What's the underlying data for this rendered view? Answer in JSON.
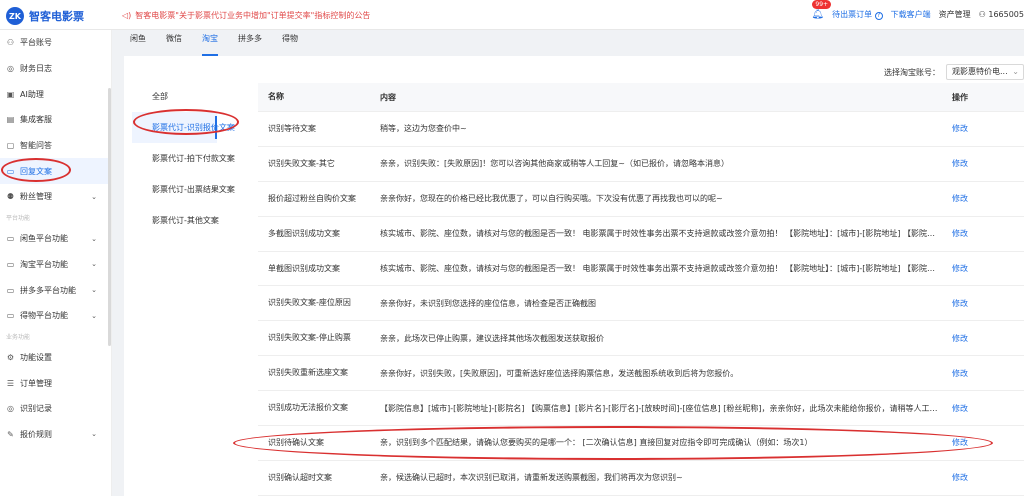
{
  "app": {
    "logo_mark": "ZK",
    "name": "智客电影票"
  },
  "notice": {
    "icon": "speaker-icon",
    "text": "智客电影票\"关于影票代订业务中增加\"订单提交率\"指标控制的公告"
  },
  "header": {
    "badge": "99+",
    "pending_orders": "待出票订单",
    "download": "下载客户端",
    "asset_mgmt": "资产管理",
    "user_id": "1665005"
  },
  "sidebar": {
    "items": [
      {
        "icon": "user-icon",
        "glyph": "⚇",
        "label": "平台账号",
        "chev": false
      },
      {
        "icon": "finance-icon",
        "glyph": "◎",
        "label": "财务日志",
        "chev": false
      },
      {
        "icon": "ai-icon",
        "glyph": "▣",
        "label": "AI助理",
        "chev": false
      },
      {
        "icon": "service-icon",
        "glyph": "▤",
        "label": "集成客服",
        "chev": false
      },
      {
        "icon": "qa-icon",
        "glyph": "▢",
        "label": "智能问答",
        "chev": false
      },
      {
        "icon": "reply-icon",
        "glyph": "▭",
        "label": "回复文案",
        "chev": false,
        "active": true
      },
      {
        "icon": "fans-icon",
        "glyph": "⚉",
        "label": "粉丝管理",
        "chev": true
      }
    ],
    "section1": "平台功能",
    "platform_items": [
      {
        "icon": "xianyu-icon",
        "glyph": "▭",
        "label": "闲鱼平台功能"
      },
      {
        "icon": "taobao-icon",
        "glyph": "▭",
        "label": "淘宝平台功能"
      },
      {
        "icon": "pdd-icon",
        "glyph": "▭",
        "label": "拼多多平台功能"
      },
      {
        "icon": "dewu-icon",
        "glyph": "▭",
        "label": "得物平台功能"
      }
    ],
    "section2": "业务功能",
    "biz_items": [
      {
        "icon": "settings-icon",
        "glyph": "⚙",
        "label": "功能设置",
        "chev": false
      },
      {
        "icon": "order-icon",
        "glyph": "☰",
        "label": "订单管理",
        "chev": false
      },
      {
        "icon": "record-icon",
        "glyph": "◎",
        "label": "识别记录",
        "chev": false
      },
      {
        "icon": "price-icon",
        "glyph": "✎",
        "label": "报价规则",
        "chev": true
      }
    ]
  },
  "platform_tabs": [
    "闲鱼",
    "微信",
    "淘宝",
    "拼多多",
    "得物"
  ],
  "account": {
    "label": "选择淘宝账号：",
    "value": "观影惠特价电..."
  },
  "categories": [
    "全部",
    "影票代订-识别报价文案",
    "影票代订-拍下付款文案",
    "影票代订-出票结果文案",
    "影票代订-其他文案"
  ],
  "table": {
    "headers": {
      "name": "名称",
      "content": "内容",
      "op": "操作"
    },
    "edit_label": "修改",
    "rows": [
      {
        "name": "识别等待文案",
        "content": "稍等，这边为您查价中~"
      },
      {
        "name": "识别失败文案-其它",
        "content": "亲亲，识别失败：[失败原因]！您可以咨询其他商家或稍等人工回复~（如已报价，请忽略本消息）"
      },
      {
        "name": "报价超过粉丝自购价文案",
        "content": "亲亲你好，您现在的价格已经比我优惠了，可以自行购买哦。下次没有优惠了再找我也可以的呢~"
      },
      {
        "name": "多截图识别成功文案",
        "content": "核实城市、影院、座位数，请核对与您的截图是否一致！ 电影票属于时效性事务出票不支持退款或改签介意勿拍！ 【影院地址】：[城市]-[影院地址] 【影院名称】..."
      },
      {
        "name": "单截图识别成功文案",
        "content": "核实城市、影院、座位数，请核对与您的截图是否一致！ 电影票属于时效性事务出票不支持退款或改签介意勿拍！ 【影院地址】：[城市]-[影院地址] 【影院名称】..."
      },
      {
        "name": "识别失败文案-座位原因",
        "content": "亲亲你好，未识别到您选择的座位信息，请检查是否正确截图"
      },
      {
        "name": "识别失败文案-停止购票",
        "content": "亲亲，此场次已停止购票，建议选择其他场次截图发送获取报价"
      },
      {
        "name": "识别失败重新选座文案",
        "content": "亲亲你好，识别失败，[失败原因]，可重新选好座位选择购票信息，发送截图系统收到后将为您报价。"
      },
      {
        "name": "识别成功无法报价文案",
        "content": "【影院信息】[城市]-[影院地址]-[影院名] 【购票信息】[影片名]-[影厅名]-[放映时间]-[座位信息] [粉丝昵称]，亲亲你好，此场次未能给你报价，请稍等人工报价~"
      },
      {
        "name": "识别待确认文案",
        "content": "亲，识别到多个匹配结果，请确认您要购买的是哪一个： [二次确认信息] 直接回复对应指令即可完成确认（例如：场次1）"
      },
      {
        "name": "识别确认超时文案",
        "content": "亲，候选确认已超时，本次识别已取消，请重新发送购票截图，我们将再次为您识别~"
      }
    ]
  },
  "colors": {
    "accent": "#1f6fe5",
    "annotation": "#d93030"
  }
}
